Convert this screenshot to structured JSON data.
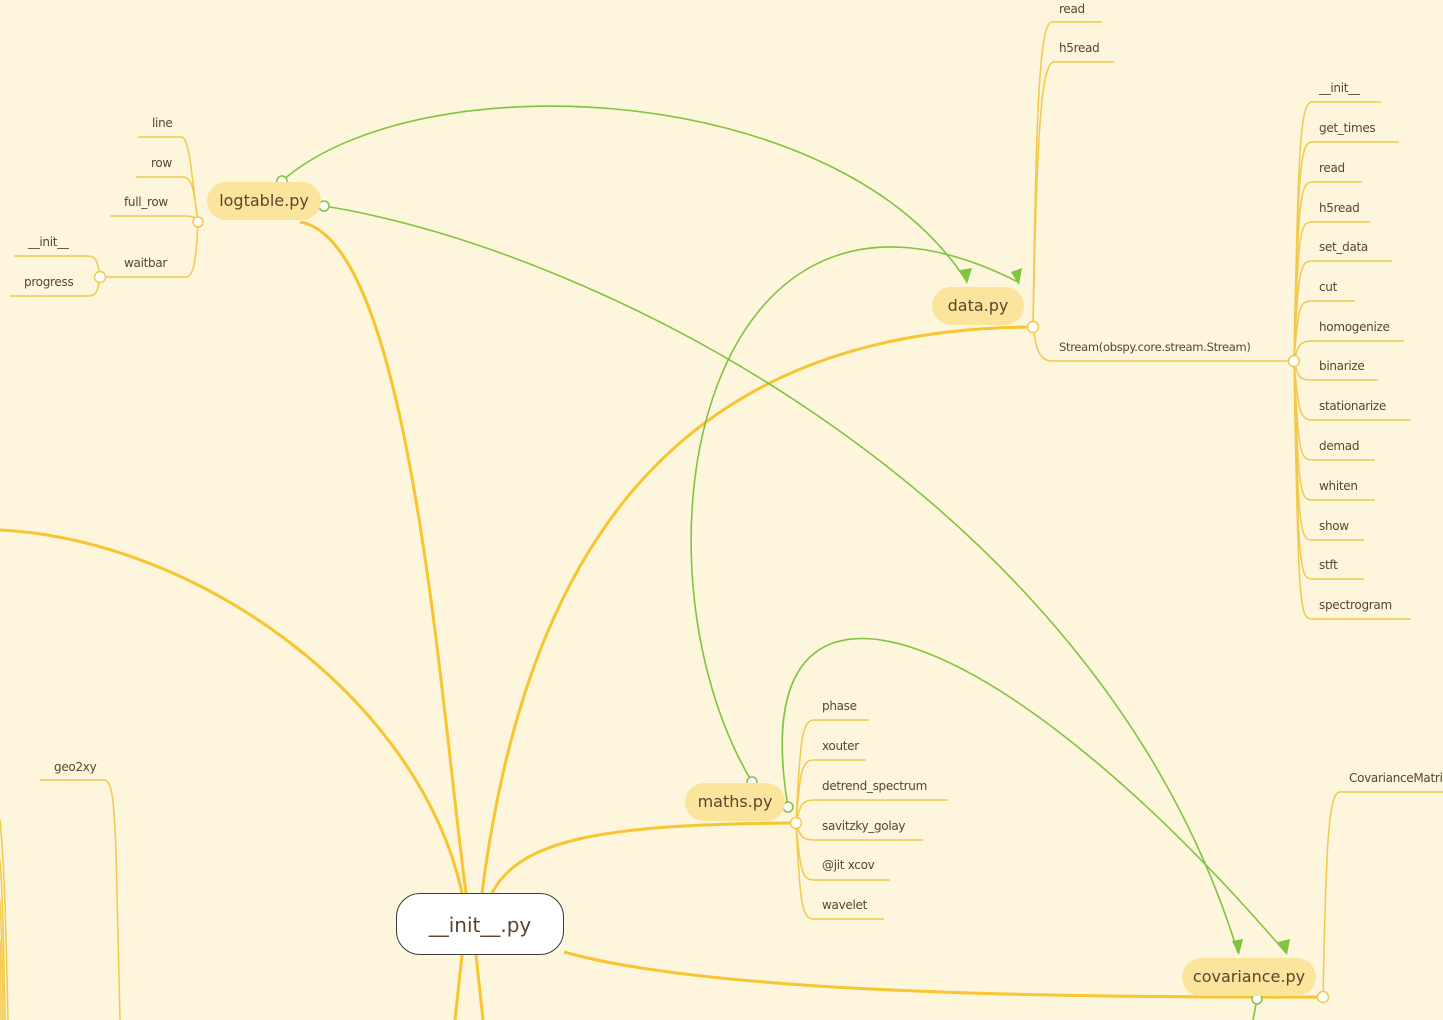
{
  "colors": {
    "background": "#fdf5dc",
    "branch": "#f7c52f",
    "leaf_line": "#f2c94c",
    "relation": "#82c341",
    "topic_fill": "#fbe49b",
    "text": "#5a4630"
  },
  "root": {
    "label": "__init__.py"
  },
  "topics": {
    "logtable": "logtable.py",
    "data": "data.py",
    "maths": "maths.py",
    "covariance": "covariance.py"
  },
  "logtable_children": [
    "line",
    "row",
    "full_row",
    "waitbar"
  ],
  "waitbar_children": [
    "__init__",
    "progress"
  ],
  "data_children": [
    "read",
    "h5read",
    "Stream(obspy.core.stream.Stream)"
  ],
  "stream_methods": [
    "__init__",
    "get_times",
    "read",
    "h5read",
    "set_data",
    "cut",
    "homogenize",
    "binarize",
    "stationarize",
    "demad",
    "whiten",
    "show",
    "stft",
    "spectrogram"
  ],
  "maths_children": [
    "phase",
    "xouter",
    "detrend_spectrum",
    "savitzky_golay",
    "@jit xcov",
    "wavelet"
  ],
  "covariance_children": [
    "CovarianceMatrix"
  ],
  "other_children": [
    "geo2xy"
  ]
}
